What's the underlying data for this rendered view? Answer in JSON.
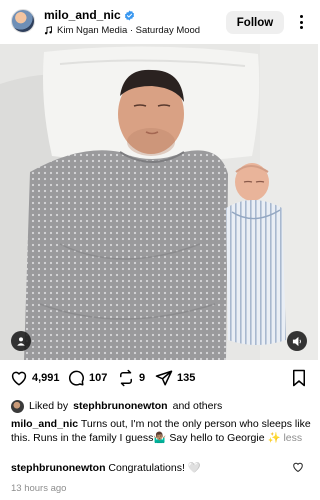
{
  "header": {
    "username": "milo_and_nic",
    "audio_label": "Kim Ngan Media · Saturday Mood",
    "follow_label": "Follow"
  },
  "icons": {
    "verified": "verified-badge-icon",
    "music": "music-note-icon",
    "more": "more-options-icon",
    "tag": "user-tag-icon",
    "sound": "sound-icon",
    "like": "heart-icon",
    "comment": "comment-icon",
    "repost": "repost-icon",
    "share": "send-icon",
    "save": "bookmark-icon"
  },
  "colors": {
    "verified": "#3897f0",
    "follow_bg": "#efefef",
    "muted": "#8e8e8e"
  },
  "actions": {
    "likes": "4,991",
    "comments": "107",
    "reposts": "9",
    "shares": "135"
  },
  "liked_by": {
    "prefix": "Liked by",
    "user": "stephbrunonewton",
    "suffix": "and others"
  },
  "caption": {
    "user": "milo_and_nic",
    "text": "Turns out, I'm not the only person who sleeps like this. Runs in the family I guess🤷🏽‍♂️ Say hello to Georgie ✨",
    "more": "less"
  },
  "comment": {
    "user": "stephbrunonewton",
    "text": "Congratulations! 🤍"
  },
  "timestamp": "13 hours ago"
}
